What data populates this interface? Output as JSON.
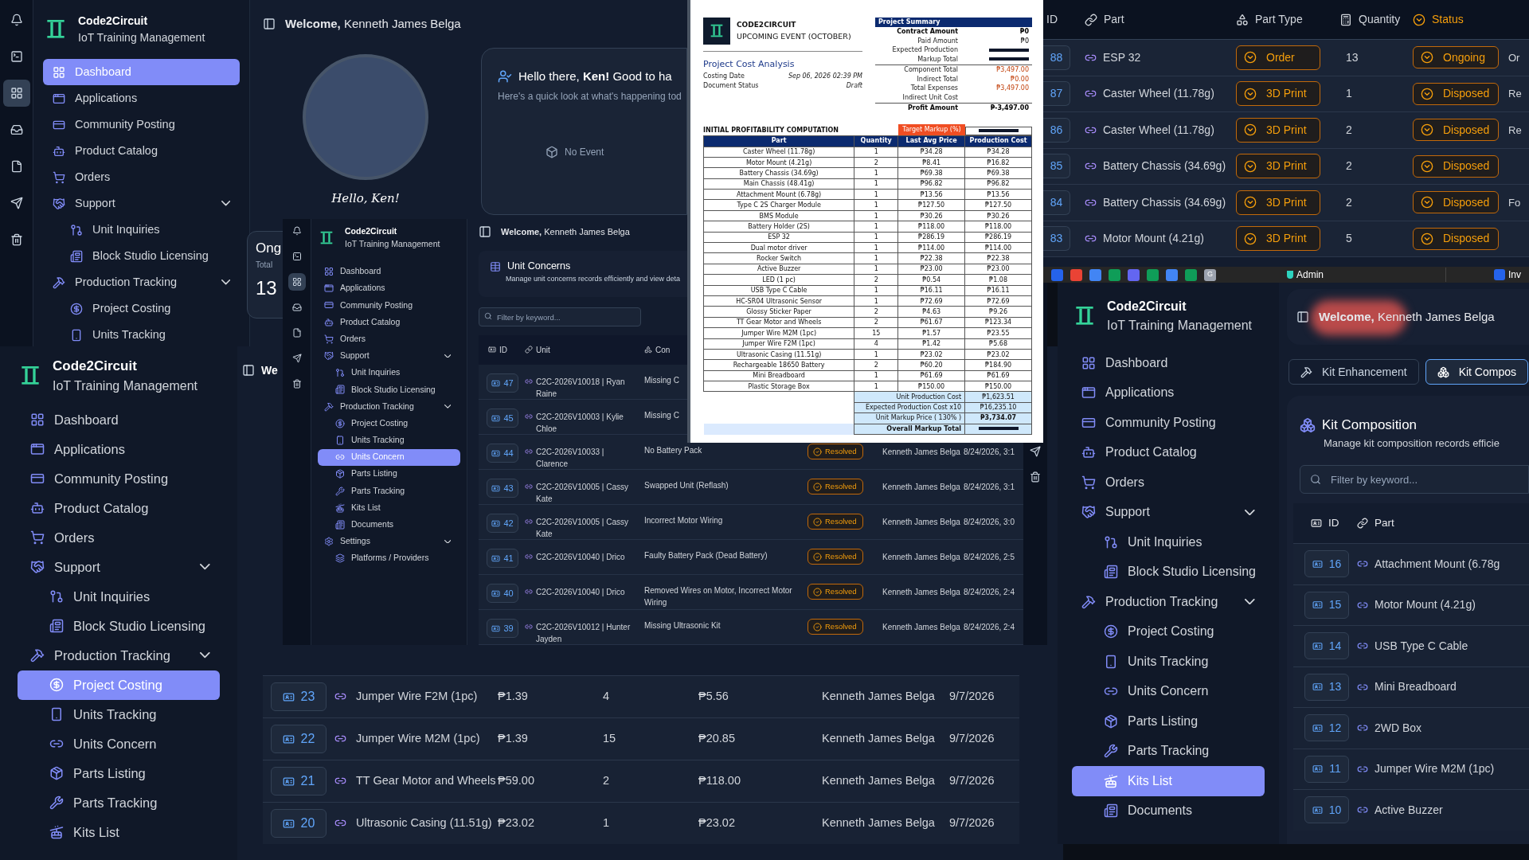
{
  "dashboard_window": {
    "rail": [
      {
        "kind": "bell",
        "selected": false
      },
      {
        "kind": "terminal",
        "selected": false
      },
      {
        "kind": "grid",
        "selected": true
      },
      {
        "kind": "inbox",
        "selected": false
      },
      {
        "kind": "file",
        "selected": false
      },
      {
        "kind": "send",
        "selected": false
      },
      {
        "kind": "trash",
        "selected": false
      }
    ],
    "brand": {
      "name": "Code2Circuit",
      "subtitle": "IoT Training Management"
    },
    "nav": [
      {
        "label": "Dashboard",
        "kind": "dashboard",
        "selected": true
      },
      {
        "label": "Applications",
        "kind": "applications",
        "selected": false
      },
      {
        "label": "Community Posting",
        "kind": "posting",
        "selected": false
      },
      {
        "label": "Product Catalog",
        "kind": "catalog",
        "selected": false
      },
      {
        "label": "Orders",
        "kind": "orders",
        "selected": false
      },
      {
        "label": "Support",
        "kind": "support",
        "selected": false,
        "expanded": true,
        "children": [
          {
            "label": "Unit Inquiries",
            "kind": "inquiries",
            "selected": false
          },
          {
            "label": "Block Studio Licensing",
            "kind": "licensing",
            "selected": false
          }
        ]
      },
      {
        "label": "Production Tracking",
        "kind": "production",
        "selected": false,
        "expanded": true,
        "children": [
          {
            "label": "Project Costing",
            "kind": "costing",
            "selected": false
          },
          {
            "label": "Units Tracking",
            "kind": "tracking",
            "selected": false
          }
        ]
      }
    ],
    "welcome": "**Welcome,** Kenneth James Belga",
    "profile": {
      "caption": "Hello, Ken!"
    },
    "hello_card": {
      "title": "Hello there, **Ken!** Good to ha",
      "subtitle": "Here's a quick look at what's happening tod",
      "empty": "No Event"
    },
    "stat_card": {
      "title": "Ong",
      "subtitle": "Total",
      "value": "13"
    }
  },
  "unit_concerns_window": {
    "rail": [
      {
        "kind": "bell",
        "selected": false
      },
      {
        "kind": "terminal",
        "selected": false
      },
      {
        "kind": "grid",
        "selected": true
      },
      {
        "kind": "inbox",
        "selected": false
      },
      {
        "kind": "file",
        "selected": false
      },
      {
        "kind": "send",
        "selected": false
      },
      {
        "kind": "trash",
        "selected": false
      }
    ],
    "brand": {
      "name": "Code2Circuit",
      "subtitle": "IoT Training Management"
    },
    "nav": [
      {
        "label": "Dashboard",
        "kind": "dashboard",
        "selected": false
      },
      {
        "label": "Applications",
        "kind": "applications",
        "selected": false
      },
      {
        "label": "Community Posting",
        "kind": "posting",
        "selected": false
      },
      {
        "label": "Product Catalog",
        "kind": "catalog",
        "selected": false
      },
      {
        "label": "Orders",
        "kind": "orders",
        "selected": false
      },
      {
        "label": "Support",
        "kind": "support",
        "selected": false,
        "expanded": true,
        "children": [
          {
            "label": "Unit Inquiries",
            "kind": "inquiries",
            "selected": false
          },
          {
            "label": "Block Studio Licensing",
            "kind": "licensing",
            "selected": false
          }
        ]
      },
      {
        "label": "Production Tracking",
        "kind": "production",
        "selected": false,
        "expanded": true,
        "children": [
          {
            "label": "Project Costing",
            "kind": "costing",
            "selected": false
          },
          {
            "label": "Units Tracking",
            "kind": "tracking",
            "selected": false
          },
          {
            "label": "Units Concern",
            "kind": "concern",
            "selected": true
          },
          {
            "label": "Parts Listing",
            "kind": "parts",
            "selected": false
          },
          {
            "label": "Parts Tracking",
            "kind": "partstracking",
            "selected": false
          },
          {
            "label": "Kits List",
            "kind": "kits",
            "selected": false
          },
          {
            "label": "Documents",
            "kind": "documents",
            "selected": false
          }
        ]
      },
      {
        "label": "Settings",
        "kind": "settings",
        "selected": false,
        "expanded": true,
        "children": [
          {
            "label": "Platforms / Providers",
            "kind": "platforms",
            "selected": false
          }
        ]
      }
    ],
    "welcome": "**Welcome,** Kenneth James Belga",
    "card": {
      "title": "Unit Concerns",
      "subtitle": "Manage unit concerns records efficiently and view deta"
    },
    "filter": {
      "placeholder": "Filter by keyword..."
    },
    "columns": [
      "ID",
      "Unit",
      "Con"
    ],
    "rows": [
      {
        "id": "47",
        "unit": "C2C-2026V10018 | Ryan Raine",
        "concern": "Missing C"
      },
      {
        "id": "45",
        "unit": "C2C-2026V10003 | Kylie Chloe",
        "concern": "Missing C"
      },
      {
        "id": "44",
        "unit": "C2C-2026V10033 | Clarence",
        "concern": "No Battery Pack",
        "status": "Resolved",
        "by": "Kenneth James Belga",
        "date": "8/24/2026, 3:1"
      },
      {
        "id": "43",
        "unit": "C2C-2026V10005 | Cassy Kate",
        "concern": "Swapped Unit (Reflash)",
        "status": "Resolved",
        "by": "Kenneth James Belga",
        "date": "8/24/2026, 3:1"
      },
      {
        "id": "42",
        "unit": "C2C-2026V10005 | Cassy Kate",
        "concern": "Incorrect Motor Wiring",
        "status": "Resolved",
        "by": "Kenneth James Belga",
        "date": "8/24/2026, 3:0"
      },
      {
        "id": "41",
        "unit": "C2C-2026V10040 | Drico",
        "concern": "Faulty Battery Pack (Dead Battery)",
        "status": "Resolved",
        "by": "Kenneth James Belga",
        "date": "8/24/2026, 2:5"
      },
      {
        "id": "40",
        "unit": "C2C-2026V10040 | Drico",
        "concern": "Removed Wires on Motor, Incorrect Motor Wiring",
        "status": "Resolved",
        "by": "Kenneth James Belga",
        "date": "8/24/2026, 2:4"
      },
      {
        "id": "39",
        "unit": "C2C-2026V10012 | Hunter Jayden",
        "concern": "Missing Ultrasonic Kit",
        "status": "Resolved",
        "by": "Kenneth James Belga",
        "date": "8/24/2026, 2:4"
      }
    ],
    "side_buttons": [
      {
        "kind": "send"
      },
      {
        "kind": "trash"
      }
    ]
  },
  "cost_document": {
    "company": "CODE2CIRCUIT",
    "event": "UPCOMING EVENT (OCTOBER)",
    "title": "Project Cost Analysis",
    "meta": [
      {
        "label": "Costing Date",
        "value": "Sep 06, 2026 02:39 PM"
      },
      {
        "label": "Document Status",
        "value": "Draft"
      }
    ],
    "summary_title": "Project Summary",
    "summary": [
      {
        "label": "Contract Amount",
        "value": "₱0",
        "kind": "bold"
      },
      {
        "label": "Paid Amount",
        "value": "₱0",
        "kind": "plain"
      },
      {
        "label": "Expected Production",
        "kind": "plain",
        "redacted": true
      },
      {
        "label": "Markup Total",
        "kind": "plain",
        "redacted": true
      },
      {
        "label": "Component Total",
        "value": "₱3,497.00",
        "kind": "expense",
        "divider_before": true
      },
      {
        "label": "Indirect Total",
        "value": "₱0.00",
        "kind": "expense"
      },
      {
        "label": "Total Expenses",
        "value": "₱3,497.00",
        "kind": "expense"
      },
      {
        "label": "Indirect Unit Cost",
        "kind": "plain"
      },
      {
        "label": "Profit Amount",
        "value": "₱-3,497.00",
        "kind": "bold",
        "divider_before": true
      }
    ],
    "section": "INITIAL PROFITABILITY COMPUTATION",
    "target_label": "Target Markup (%)",
    "target_redacted": true,
    "columns": [
      "Part",
      "Quantity",
      "Last Avg Price",
      "Production Cost"
    ],
    "rows": [
      [
        "Caster Wheel (11.78g)",
        "1",
        "₱34.28",
        "₱34.28"
      ],
      [
        "Motor Mount (4.21g)",
        "2",
        "₱8.41",
        "₱16.82"
      ],
      [
        "Battery Chassis (34.69g)",
        "1",
        "₱69.38",
        "₱69.38"
      ],
      [
        "Main Chassis (48.41g)",
        "1",
        "₱96.82",
        "₱96.82"
      ],
      [
        "Attachment Mount (6.78g)",
        "1",
        "₱13.56",
        "₱13.56"
      ],
      [
        "Type C 2S Charger Module",
        "1",
        "₱127.50",
        "₱127.50"
      ],
      [
        "BMS Module",
        "1",
        "₱30.26",
        "₱30.26"
      ],
      [
        "Battery Holder (2S)",
        "1",
        "₱118.00",
        "₱118.00"
      ],
      [
        "ESP 32",
        "1",
        "₱286.19",
        "₱286.19"
      ],
      [
        "Dual motor driver",
        "1",
        "₱114.00",
        "₱114.00"
      ],
      [
        "Rocker Switch",
        "1",
        "₱22.38",
        "₱22.38"
      ],
      [
        "Active Buzzer",
        "1",
        "₱23.00",
        "₱23.00"
      ],
      [
        "LED (1 pc)",
        "2",
        "₱0.54",
        "₱1.08"
      ],
      [
        "USB Type C Cable",
        "1",
        "₱16.11",
        "₱16.11"
      ],
      [
        "HC-SR04 Ultrasonic Sensor",
        "1",
        "₱72.69",
        "₱72.69"
      ],
      [
        "Glossy Sticker Paper",
        "2",
        "₱4.63",
        "₱9.26"
      ],
      [
        "TT Gear Motor and Wheels",
        "2",
        "₱61.67",
        "₱123.34"
      ],
      [
        "Jumper Wire M2M (1pc)",
        "15",
        "₱1.57",
        "₱23.55"
      ],
      [
        "Jumper Wire F2M (1pc)",
        "4",
        "₱1.42",
        "₱5.68"
      ],
      [
        "Ultrasonic Casing (11.51g)",
        "1",
        "₱23.02",
        "₱23.02"
      ],
      [
        "Rechargeable 18650 Battery",
        "2",
        "₱60.20",
        "₱184.90"
      ],
      [
        "Mini Breadboard",
        "1",
        "₱61.69",
        "₱61.69"
      ],
      [
        "Plastic Storage Box",
        "1",
        "₱150.00",
        "₱150.00"
      ]
    ],
    "totals": [
      {
        "label": "Unit Production Cost",
        "value": "₱1,623.51",
        "kind": "plain"
      },
      {
        "label": "Expected Production Cost x10",
        "value": "₱16,235.10",
        "kind": "plain"
      },
      {
        "label": "Unit Markup Price ( 130% )",
        "value": "₱3,734.07",
        "kind": "markup"
      },
      {
        "label": "Overall Markup Total",
        "kind": "overall",
        "redacted": true
      }
    ]
  },
  "parts_window": {
    "columns": [
      {
        "label": "ID",
        "kind": "id"
      },
      {
        "label": "Part",
        "kind": "part"
      },
      {
        "label": "Part Type",
        "kind": "type"
      },
      {
        "label": "Quantity",
        "kind": "qty"
      },
      {
        "label": "Status",
        "kind": "status"
      }
    ],
    "rows": [
      {
        "id": "88",
        "part": "ESP 32",
        "type": "Order",
        "qty": "13",
        "status": "Ongoing",
        "extra": "Or"
      },
      {
        "id": "87",
        "part": "Caster Wheel (11.78g)",
        "type": "3D Print",
        "qty": "1",
        "status": "Disposed",
        "extra": "Re"
      },
      {
        "id": "86",
        "part": "Caster Wheel (11.78g)",
        "type": "3D Print",
        "qty": "2",
        "status": "Disposed",
        "extra": "Re"
      },
      {
        "id": "85",
        "part": "Battery Chassis (34.69g)",
        "type": "3D Print",
        "qty": "2",
        "status": "Disposed"
      },
      {
        "id": "84",
        "part": "Battery Chassis (34.69g)",
        "type": "3D Print",
        "qty": "2",
        "status": "Disposed",
        "extra": "Fo"
      },
      {
        "id": "83",
        "part": "Motor Mount (4.21g)",
        "type": "3D Print",
        "qty": "5",
        "status": "Disposed"
      }
    ],
    "dock": {
      "apps": [
        {
          "color": "#2563eb"
        },
        {
          "color": "#ea4335"
        },
        {
          "color": "#4285f4"
        },
        {
          "color": "#0f9d58"
        },
        {
          "color": "#6366f1"
        },
        {
          "color": "#0f9d58"
        },
        {
          "color": "#4285f4"
        },
        {
          "color": "#0f9d58"
        },
        {
          "color": "#9ca3af",
          "label": "G"
        }
      ],
      "user": "Admin",
      "tab": "Inv"
    }
  },
  "costing_window": {
    "brand": {
      "name": "Code2Circuit",
      "subtitle": "IoT Training Management"
    },
    "nav": [
      {
        "label": "Dashboard",
        "kind": "dashboard",
        "selected": false
      },
      {
        "label": "Applications",
        "kind": "applications",
        "selected": false
      },
      {
        "label": "Community Posting",
        "kind": "posting",
        "selected": false
      },
      {
        "label": "Product Catalog",
        "kind": "catalog",
        "selected": false
      },
      {
        "label": "Orders",
        "kind": "orders",
        "selected": false
      },
      {
        "label": "Support",
        "kind": "support",
        "selected": false,
        "expanded": true,
        "children": [
          {
            "label": "Unit Inquiries",
            "kind": "inquiries",
            "selected": false
          },
          {
            "label": "Block Studio Licensing",
            "kind": "licensing",
            "selected": false
          }
        ]
      },
      {
        "label": "Production Tracking",
        "kind": "production",
        "selected": false,
        "expanded": true,
        "children": [
          {
            "label": "Project Costing",
            "kind": "costing",
            "selected": true
          },
          {
            "label": "Units Tracking",
            "kind": "tracking",
            "selected": false
          },
          {
            "label": "Units Concern",
            "kind": "concern",
            "selected": false
          },
          {
            "label": "Parts Listing",
            "kind": "parts",
            "selected": false
          },
          {
            "label": "Parts Tracking",
            "kind": "partstracking",
            "selected": false
          },
          {
            "label": "Kits List",
            "kind": "kits",
            "selected": false
          }
        ]
      }
    ],
    "welcome": "We",
    "rows": [
      {
        "id": "23",
        "part": "Jumper Wire F2M (1pc)",
        "price": "₱1.39",
        "qty": "4",
        "total": "₱5.56",
        "by": "Kenneth James Belga",
        "date": "9/7/2026"
      },
      {
        "id": "22",
        "part": "Jumper Wire M2M (1pc)",
        "price": "₱1.39",
        "qty": "15",
        "total": "₱20.85",
        "by": "Kenneth James Belga",
        "date": "9/7/2026"
      },
      {
        "id": "21",
        "part": "TT Gear Motor and Wheels",
        "price": "₱59.00",
        "qty": "2",
        "total": "₱118.00",
        "by": "Kenneth James Belga",
        "date": "9/7/2026"
      },
      {
        "id": "20",
        "part": "Ultrasonic Casing (11.51g)",
        "price": "₱23.02",
        "qty": "1",
        "total": "₱23.02",
        "by": "Kenneth James Belga",
        "date": "9/7/2026"
      }
    ]
  },
  "kits_window": {
    "brand": {
      "name": "Code2Circuit",
      "subtitle": "IoT Training Management"
    },
    "nav": [
      {
        "label": "Dashboard",
        "kind": "dashboard",
        "selected": false
      },
      {
        "label": "Applications",
        "kind": "applications",
        "selected": false
      },
      {
        "label": "Community Posting",
        "kind": "posting",
        "selected": false
      },
      {
        "label": "Product Catalog",
        "kind": "catalog",
        "selected": false
      },
      {
        "label": "Orders",
        "kind": "orders",
        "selected": false
      },
      {
        "label": "Support",
        "kind": "support",
        "selected": false,
        "expanded": true,
        "children": [
          {
            "label": "Unit Inquiries",
            "kind": "inquiries",
            "selected": false
          },
          {
            "label": "Block Studio Licensing",
            "kind": "licensing",
            "selected": false
          }
        ]
      },
      {
        "label": "Production Tracking",
        "kind": "production",
        "selected": false,
        "expanded": true,
        "children": [
          {
            "label": "Project Costing",
            "kind": "costing",
            "selected": false
          },
          {
            "label": "Units Tracking",
            "kind": "tracking",
            "selected": false
          },
          {
            "label": "Units Concern",
            "kind": "concern",
            "selected": false
          },
          {
            "label": "Parts Listing",
            "kind": "parts",
            "selected": false
          },
          {
            "label": "Parts Tracking",
            "kind": "partstracking",
            "selected": false
          },
          {
            "label": "Kits List",
            "kind": "kits",
            "selected": true
          },
          {
            "label": "Documents",
            "kind": "documents",
            "selected": false
          }
        ]
      }
    ],
    "welcome": "**Welcome,** Kenneth James Belga",
    "welcome_highlighted": true,
    "tabs": [
      {
        "label": "Kit Enhancement",
        "kind": "hammer",
        "selected": false
      },
      {
        "label": "Kit Compos",
        "kind": "boxes",
        "selected": true
      }
    ],
    "card": {
      "title": "Kit Composition",
      "subtitle": "Manage kit composition records efficie"
    },
    "filter": {
      "placeholder": "Filter by keyword..."
    },
    "columns": [
      "ID",
      "Part"
    ],
    "rows": [
      {
        "id": "16",
        "part": "Attachment Mount (6.78g"
      },
      {
        "id": "15",
        "part": "Motor Mount (4.21g)"
      },
      {
        "id": "14",
        "part": "USB Type C Cable"
      },
      {
        "id": "13",
        "part": "Mini Breadboard"
      },
      {
        "id": "12",
        "part": "2WD Box"
      },
      {
        "id": "11",
        "part": "Jumper Wire M2M (1pc)"
      },
      {
        "id": "10",
        "part": "Active Buzzer"
      }
    ]
  }
}
